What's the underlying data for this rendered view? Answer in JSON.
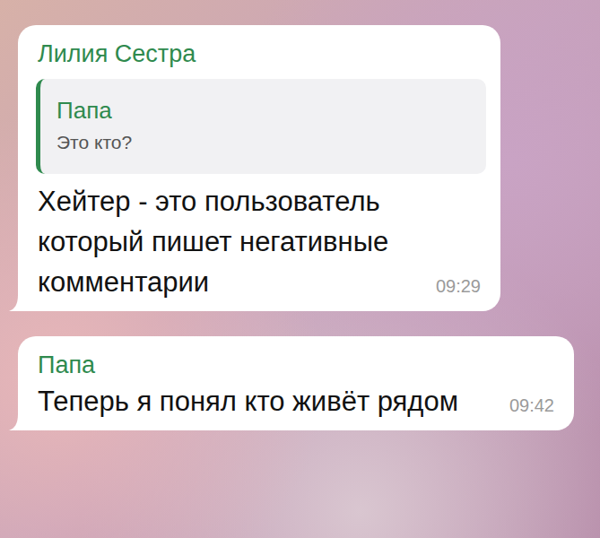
{
  "chat": {
    "messages": [
      {
        "sender": "Лилия Сестра",
        "reply": {
          "sender": "Папа",
          "text": "Это кто?"
        },
        "text": "Хейтер - это пользователь который пишет негативные комментарии",
        "time": "09:29"
      },
      {
        "sender": "Папа",
        "reply": null,
        "text": "Теперь я понял кто живёт рядом",
        "time": "09:42"
      }
    ]
  }
}
